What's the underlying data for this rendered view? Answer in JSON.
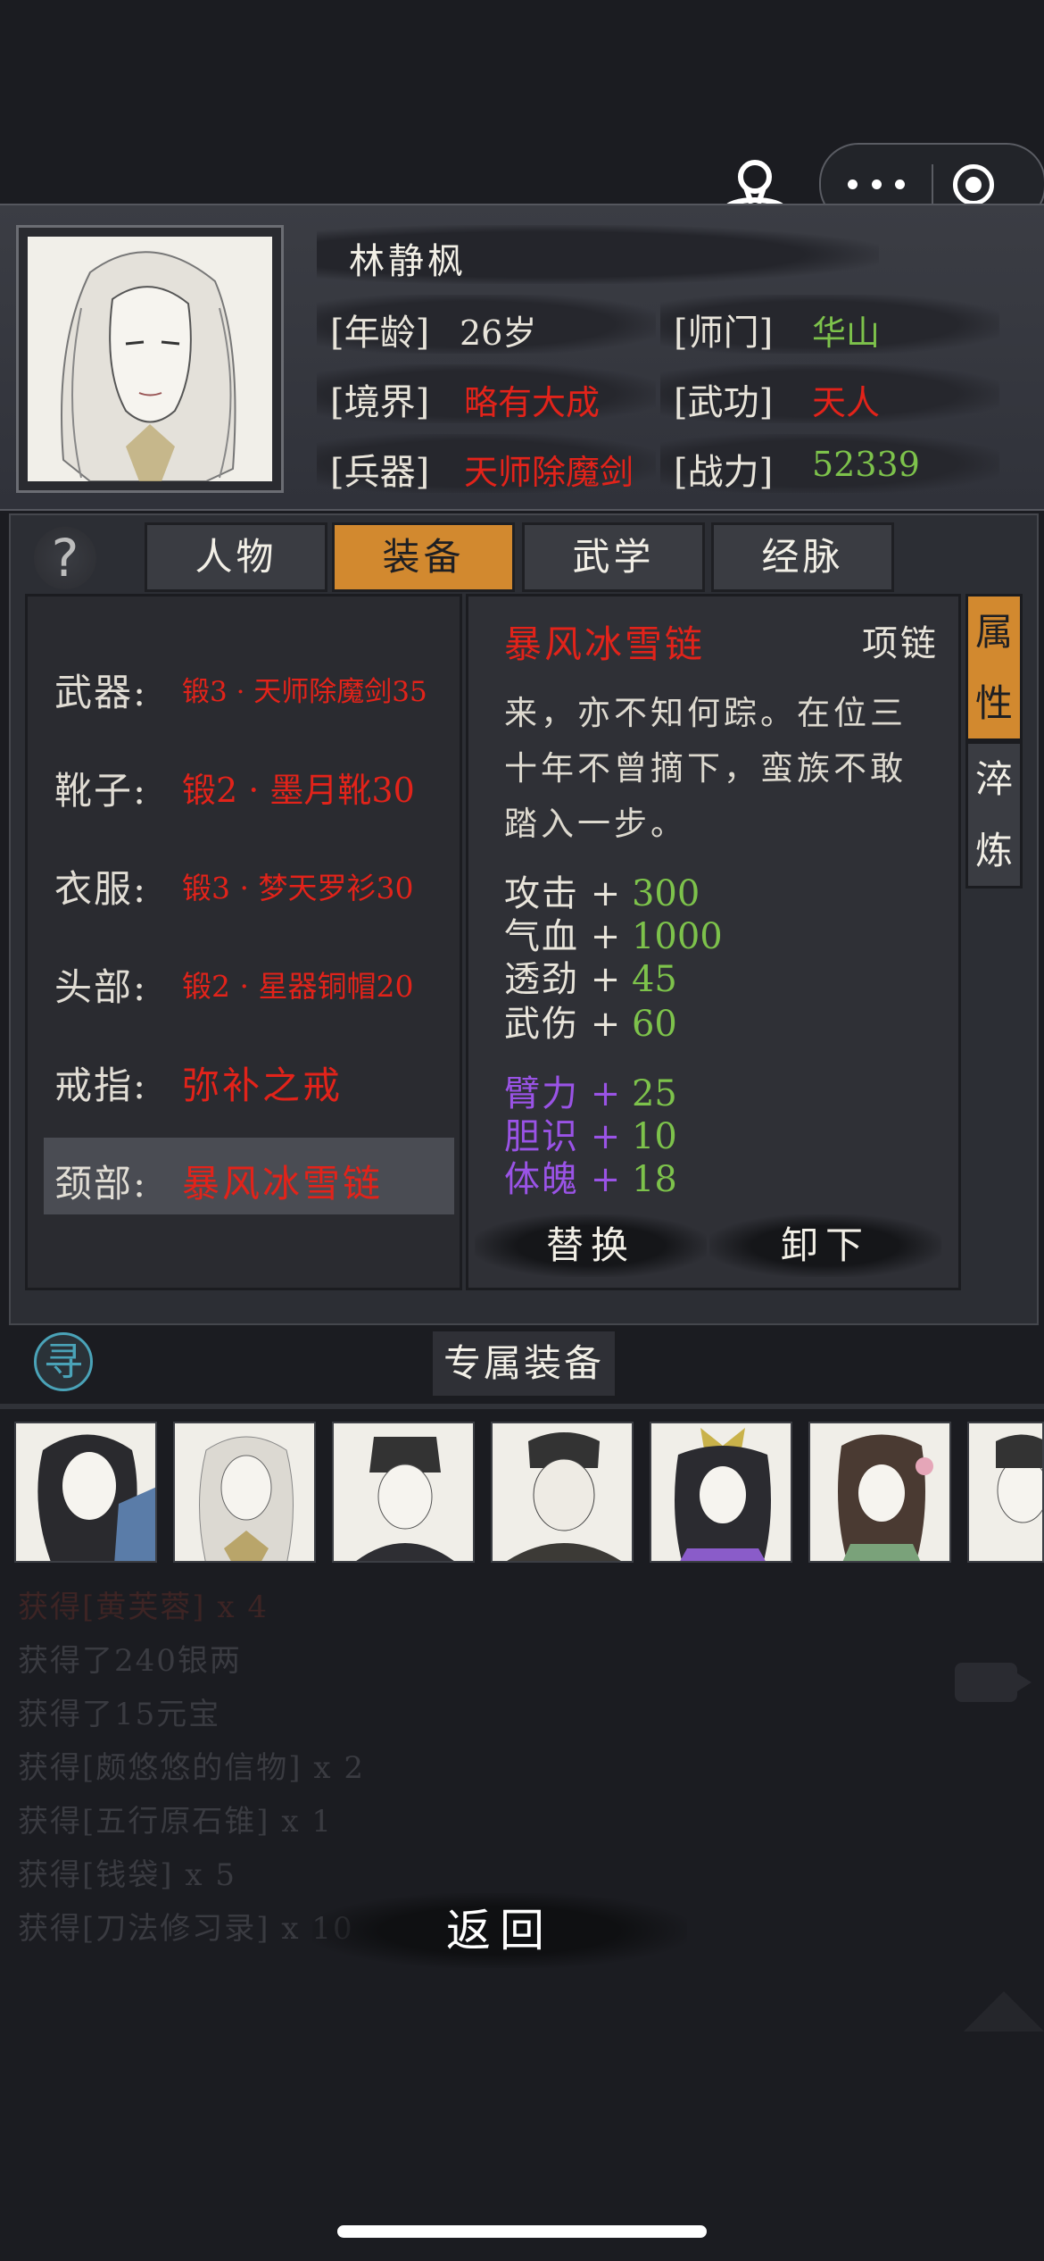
{
  "character": {
    "name": "林静枫",
    "age_label": "[年龄]",
    "age": "26岁",
    "sect_label": "[师门]",
    "sect": "华山",
    "realm_label": "[境界]",
    "realm": "略有大成",
    "martial_label": "[武功]",
    "martial": "天人",
    "weapon_label": "[兵器]",
    "weapon": "天师除魔剑",
    "power_label": "[战力]",
    "power": "52339"
  },
  "help_icon": "?",
  "tabs": [
    {
      "label": "人物",
      "active": false
    },
    {
      "label": "装备",
      "active": true
    },
    {
      "label": "武学",
      "active": false
    },
    {
      "label": "经脉",
      "active": false
    }
  ],
  "slots": [
    {
      "label": "武器:",
      "value": "锻3 · 天师除魔剑35"
    },
    {
      "label": "靴子:",
      "value": "锻2 · 墨月靴30"
    },
    {
      "label": "衣服:",
      "value": "锻3 · 梦天罗衫30"
    },
    {
      "label": "头部:",
      "value": "锻2 · 星器铜帽20"
    },
    {
      "label": "戒指:",
      "value": "弥补之戒"
    },
    {
      "label": "颈部:",
      "value": "暴风冰雪链"
    }
  ],
  "detail": {
    "name": "暴风冰雪链",
    "type": "项链",
    "description": "来，亦不知何踪。在位三十年不曾摘下，蛮族不敢踏入一步。",
    "stats": [
      {
        "key": "攻击",
        "value": "300"
      },
      {
        "key": "气血",
        "value": "1000"
      },
      {
        "key": "透劲",
        "value": "45"
      },
      {
        "key": "武伤",
        "value": "60"
      }
    ],
    "bonus_stats": [
      {
        "key": "臂力",
        "value": "25"
      },
      {
        "key": "胆识",
        "value": "10"
      },
      {
        "key": "体魄",
        "value": "18"
      }
    ],
    "plus": "+",
    "replace_button": "替换",
    "unequip_button": "卸下"
  },
  "side_tabs": [
    {
      "label_1": "属",
      "label_2": "性",
      "active": true
    },
    {
      "label_1": "淬",
      "label_2": "炼",
      "active": false
    }
  ],
  "seek_icon": "寻",
  "exclusive_button": "专属装备",
  "log": [
    "获得[黄芙蓉] x 4",
    "获得了240银两",
    "获得了15元宝",
    "获得[颇悠悠的信物] x 2",
    "获得[五行原石锥] x 1",
    "获得[钱袋] x 5",
    "获得[刀法修习录] x 10"
  ],
  "back_button": "返回",
  "colors": {
    "accent": "#d2892f",
    "red": "#e2231a",
    "green": "#7dc24b",
    "purple": "#9a53e6"
  }
}
